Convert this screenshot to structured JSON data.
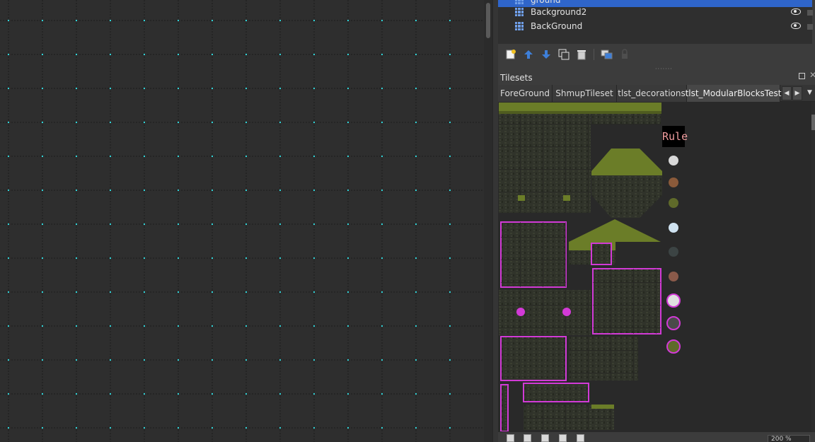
{
  "layers": {
    "items": [
      {
        "name": "ground",
        "selected": true,
        "visible": true
      },
      {
        "name": "Background2",
        "selected": false,
        "visible": true
      },
      {
        "name": "BackGround",
        "selected": false,
        "visible": true
      }
    ],
    "toolbar_icons": [
      "new-layer-icon",
      "raise-layer-icon",
      "lower-layer-icon",
      "duplicate-layer-icon",
      "delete-layer-icon",
      "merge-layer-icon",
      "lock-layer-icon"
    ]
  },
  "tilesets": {
    "title": "Tilesets",
    "tabs": [
      {
        "label": "ForeGround",
        "active": false
      },
      {
        "label": "ShmupTileset",
        "active": false
      },
      {
        "label": "tlst_decorations",
        "active": false
      },
      {
        "label": "tlst_ModularBlocksTest",
        "active": true
      }
    ],
    "rule_label": "Rule"
  },
  "colors": {
    "grid_dot": "#2fd3d7",
    "selection": "#2f65ca",
    "moss": "#6b7d28",
    "rock": "#33362a",
    "crystal": "#d23ad6"
  },
  "bottom": {
    "zoom": "200 %"
  }
}
